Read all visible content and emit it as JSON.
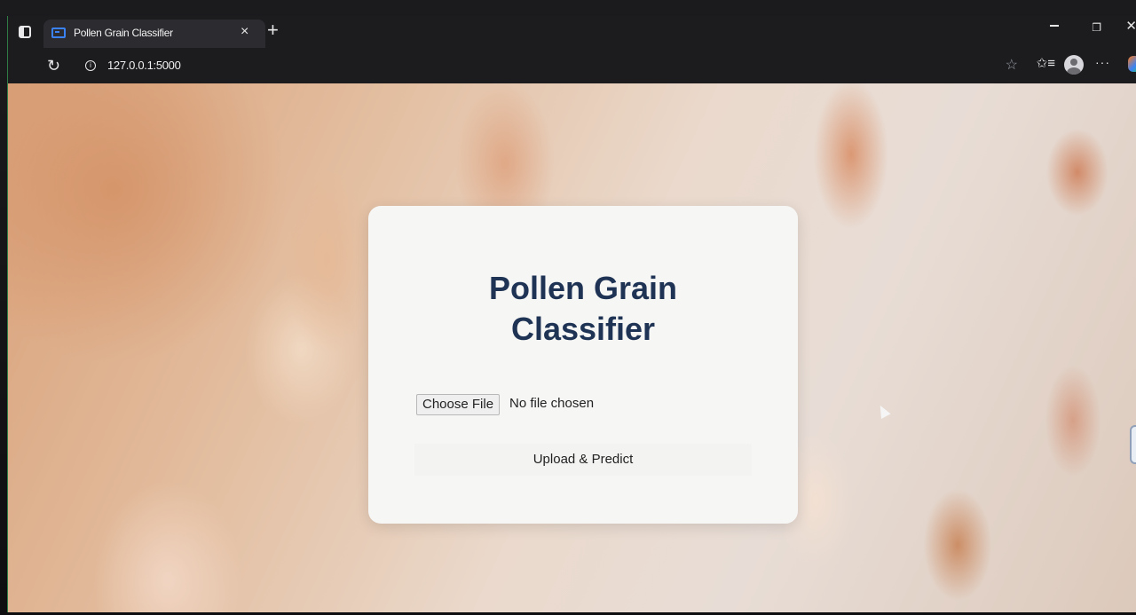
{
  "browser": {
    "tab": {
      "title": "Pollen Grain Classifier",
      "close_glyph": "×"
    },
    "new_tab_glyph": "+",
    "address": {
      "url": "127.0.0.1:5000",
      "info_glyph": "i"
    },
    "icons": {
      "reload": "reload-icon",
      "favorite": "star-icon",
      "favorites": "favorites-icon",
      "profile": "profile-icon",
      "more": "more-icon"
    },
    "more_glyph": "···",
    "star_glyph": "☆",
    "favorites_glyph": "✩≡",
    "reload_glyph": "↻"
  },
  "page": {
    "title_line1": "Pollen Grain",
    "title_line2": "Classifier",
    "file_input": {
      "button_label": "Choose File",
      "status": "No file chosen"
    },
    "submit_label": "Upload & Predict"
  },
  "colors": {
    "title": "#1f3354",
    "card": "#f6f6f5",
    "accent": "#3b82f6"
  }
}
